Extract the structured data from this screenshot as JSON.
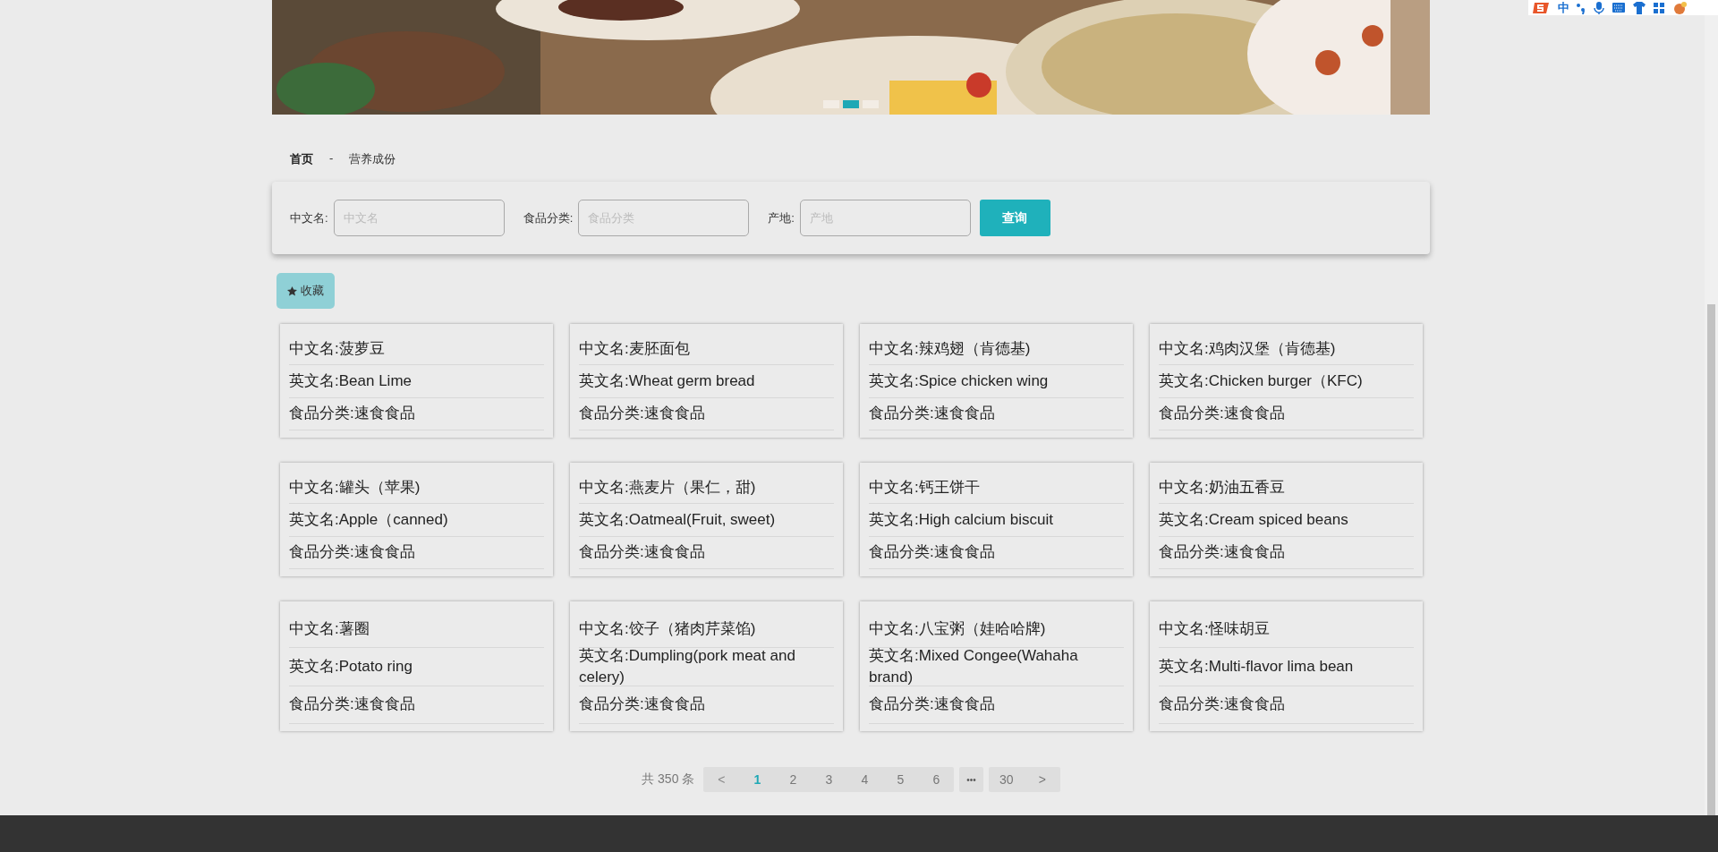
{
  "ime_toolbar": {
    "mode": "中"
  },
  "banner": {
    "dots": [
      {
        "selected": false
      },
      {
        "selected": true
      },
      {
        "selected": false
      }
    ]
  },
  "breadcrumb": {
    "items": [
      "首页",
      "营养成份"
    ],
    "separator": "-"
  },
  "search": {
    "fields": [
      {
        "label": "中文名:",
        "placeholder": "中文名"
      },
      {
        "label": "食品分类:",
        "placeholder": "食品分类"
      },
      {
        "label": "产地:",
        "placeholder": "产地"
      }
    ],
    "button": "查询"
  },
  "favorite_button": "收藏",
  "cards": [
    {
      "lines": [
        "中文名:菠萝豆",
        "英文名:Bean Lime",
        "食品分类:速食食品"
      ]
    },
    {
      "lines": [
        "中文名:麦胚面包",
        "英文名:Wheat germ bread",
        "食品分类:速食食品"
      ]
    },
    {
      "lines": [
        "中文名:辣鸡翅（肯德基)",
        "英文名:Spice chicken wing",
        "食品分类:速食食品"
      ]
    },
    {
      "lines": [
        "中文名:鸡肉汉堡（肯德基)",
        "英文名:Chicken burger（KFC)",
        "食品分类:速食食品"
      ]
    },
    {
      "lines": [
        "中文名:罐头（苹果)",
        "英文名:Apple（canned)",
        "食品分类:速食食品"
      ]
    },
    {
      "lines": [
        "中文名:燕麦片（果仁，甜)",
        "英文名:Oatmeal(Fruit, sweet)",
        "食品分类:速食食品"
      ]
    },
    {
      "lines": [
        "中文名:钙王饼干",
        "英文名:High calcium biscuit",
        "食品分类:速食食品"
      ]
    },
    {
      "lines": [
        "中文名:奶油五香豆",
        "英文名:Cream spiced beans",
        "食品分类:速食食品"
      ]
    },
    {
      "lines": [
        "中文名:薯圈",
        "英文名:Potato ring",
        "食品分类:速食食品"
      ]
    },
    {
      "lines": [
        "中文名:饺子（猪肉芹菜馅)",
        "英文名:Dumpling(pork meat and celery)",
        "食品分类:速食食品"
      ]
    },
    {
      "lines": [
        "中文名:八宝粥（娃哈哈牌)",
        "英文名:Mixed Congee(Wahaha brand)",
        "食品分类:速食食品"
      ]
    },
    {
      "lines": [
        "中文名:怪味胡豆",
        "英文名:Multi-flavor lima bean",
        "食品分类:速食食品"
      ]
    }
  ],
  "pagination": {
    "total": "共 350 条",
    "prev": {
      "label": "<",
      "disabled": true
    },
    "pages": [
      {
        "label": "1",
        "selected": true
      },
      {
        "label": "2",
        "selected": false
      },
      {
        "label": "3",
        "selected": false
      },
      {
        "label": "4",
        "selected": false
      },
      {
        "label": "5",
        "selected": false
      },
      {
        "label": "6",
        "selected": false
      }
    ],
    "ellipsis": "•••",
    "last": {
      "label": "30",
      "selected": false
    },
    "next": {
      "label": ">",
      "disabled": false
    }
  }
}
